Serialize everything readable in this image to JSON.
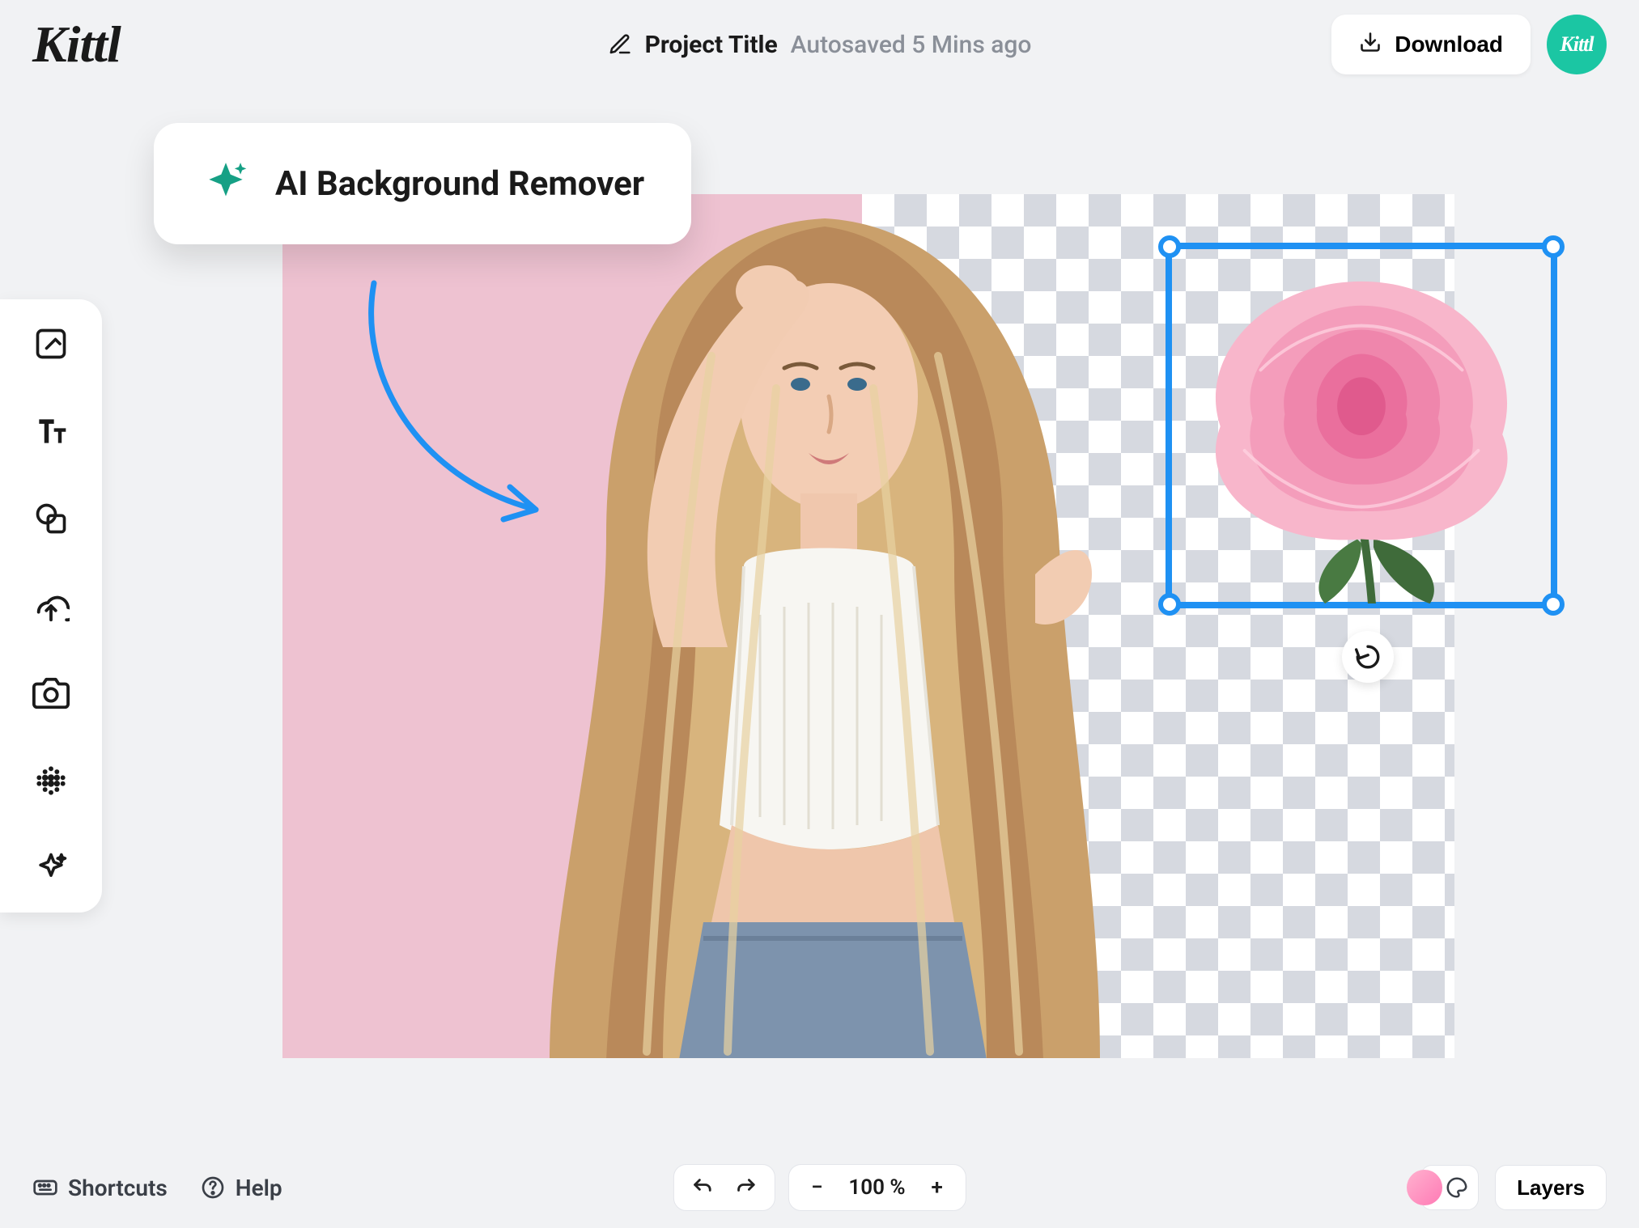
{
  "header": {
    "logo_text": "Kittl",
    "project_title": "Project Title",
    "autosave_text": "Autosaved 5 Mins ago",
    "download_label": "Download",
    "badge_text": "Kittl"
  },
  "toolbar": {
    "tools": [
      {
        "name": "design-tool",
        "icon": "design"
      },
      {
        "name": "text-tool",
        "icon": "text"
      },
      {
        "name": "shapes-tool",
        "icon": "shapes"
      },
      {
        "name": "upload-tool",
        "icon": "upload"
      },
      {
        "name": "photo-tool",
        "icon": "camera"
      },
      {
        "name": "texture-tool",
        "icon": "dots"
      },
      {
        "name": "ai-tool",
        "icon": "sparkle"
      }
    ]
  },
  "feature": {
    "label": "AI Background Remover"
  },
  "selection": {
    "object": "rose",
    "rotate_label": "Rotate"
  },
  "footer": {
    "shortcuts_label": "Shortcuts",
    "help_label": "Help",
    "zoom": {
      "value": "100 %",
      "minus": "−",
      "plus": "+"
    },
    "layers_label": "Layers"
  },
  "colors": {
    "accent": "#1bc6a3",
    "selection": "#1f91f3",
    "pink": "#eec2d1"
  }
}
